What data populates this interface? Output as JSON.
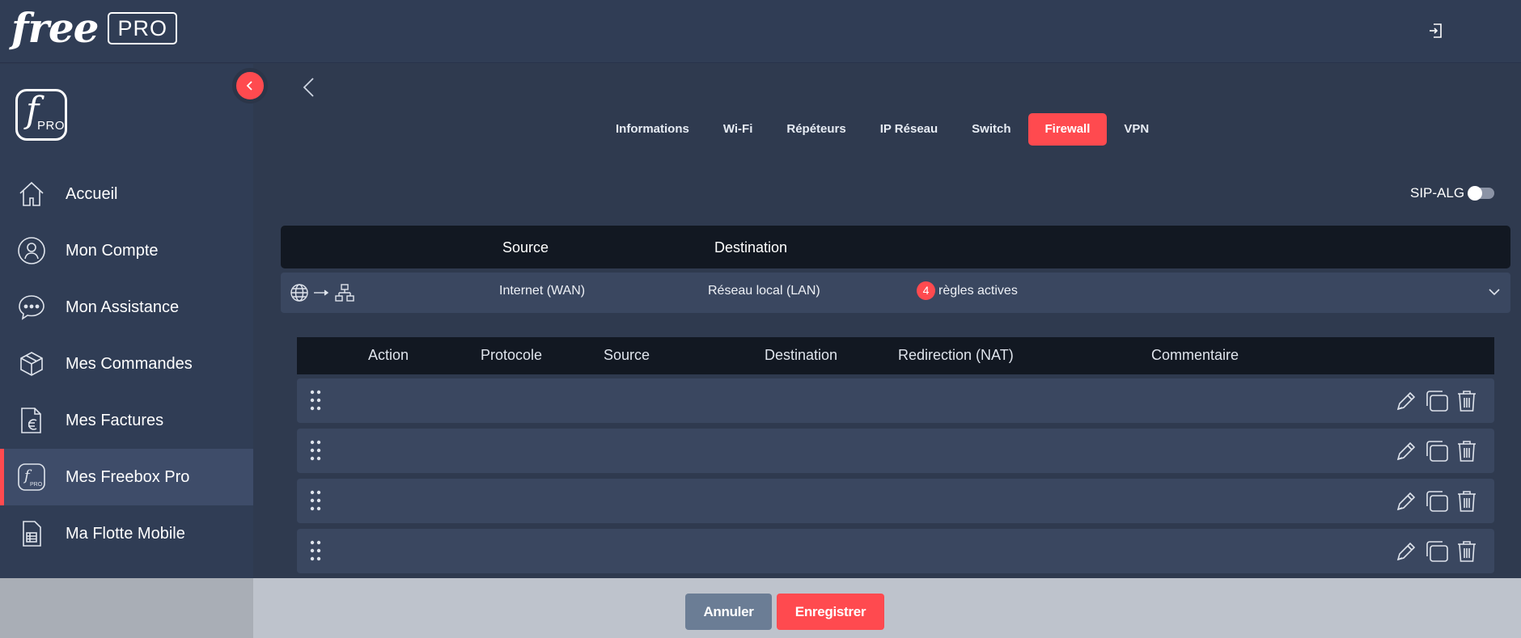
{
  "brand": {
    "name": "free",
    "tag": "PRO"
  },
  "sidebar": {
    "logo": {
      "letter": "f",
      "tag": "PRO"
    },
    "items": [
      {
        "label": "Accueil",
        "icon": "home-icon"
      },
      {
        "label": "Mon Compte",
        "icon": "user-icon"
      },
      {
        "label": "Mon Assistance",
        "icon": "chat-icon"
      },
      {
        "label": "Mes Commandes",
        "icon": "package-icon"
      },
      {
        "label": "Mes Factures",
        "icon": "invoice-euro-icon"
      },
      {
        "label": "Mes Freebox Pro",
        "icon": "freebox-pro-icon",
        "active": true
      },
      {
        "label": "Ma Flotte Mobile",
        "icon": "sim-card-icon"
      }
    ]
  },
  "tabs": [
    {
      "label": "Informations"
    },
    {
      "label": "Wi-Fi"
    },
    {
      "label": "Répéteurs"
    },
    {
      "label": "IP Réseau"
    },
    {
      "label": "Switch"
    },
    {
      "label": "Firewall",
      "active": true
    },
    {
      "label": "VPN"
    }
  ],
  "sip_alg": {
    "label": "SIP-ALG",
    "enabled": false
  },
  "header": {
    "source": "Source",
    "destination": "Destination"
  },
  "summary": {
    "source": "Internet (WAN)",
    "destination": "Réseau local (LAN)",
    "count": "4",
    "count_label": "règles actives"
  },
  "rules_table": {
    "columns": [
      "Action",
      "Protocole",
      "Source",
      "Destination",
      "Redirection (NAT)",
      "Commentaire"
    ],
    "rows": 4
  },
  "footer": {
    "cancel": "Annuler",
    "save": "Enregistrer"
  },
  "colors": {
    "accent": "#ff4a4f",
    "background": "#2f3a4f",
    "sidebar": "#303d55",
    "dark": "#121822"
  }
}
